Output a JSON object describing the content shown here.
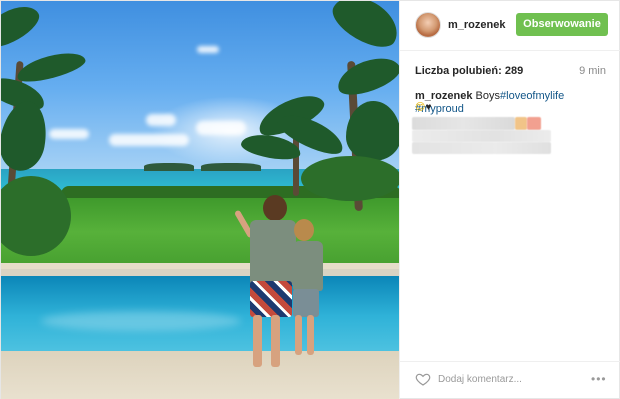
{
  "header": {
    "username": "m_rozenek",
    "follow_label": "Obserwowanie",
    "follow_color": "#70c050"
  },
  "stats": {
    "likes_text": "Liczba polubień: 289",
    "time_ago": "9 min"
  },
  "caption": {
    "author": "m_rozenek",
    "text": "Boys",
    "hashtag1": "#loveofmylife",
    "hashtag2": "#myproud",
    "emoji1": "😊",
    "emoji2": "♥"
  },
  "footer": {
    "comment_placeholder": "Dodaj komentarz...",
    "more_symbol": "•••"
  },
  "icons": {
    "like": "heart-outline-icon",
    "more": "more-options-icon"
  },
  "colors": {
    "hashtag": "#125688",
    "text": "#262626",
    "muted": "#8a8a8a"
  }
}
